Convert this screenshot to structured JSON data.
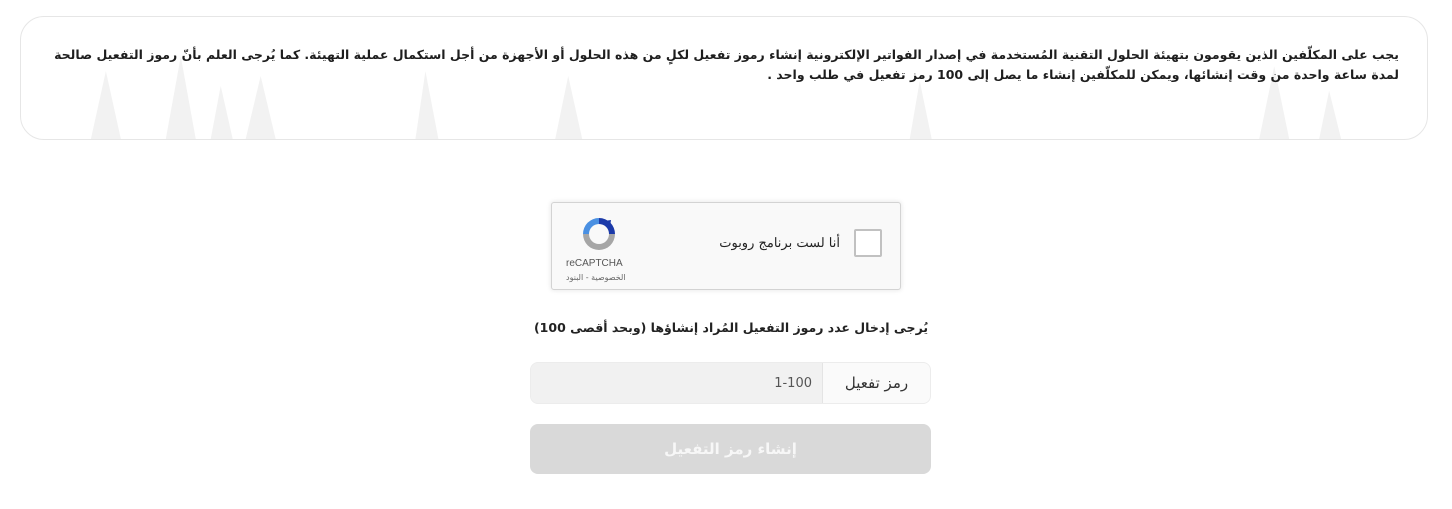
{
  "notice": {
    "text": "يجب على المكلّفين الذين يقومون بتهيئة الحلول التقنية المُستخدمة في إصدار الفواتير الإلكترونية إنشاء رموز تفعيل لكلٍ من هذه الحلول أو الأجهزة من أجل استكمال عملية التهيئة. كما يُرجى العلم بأنّ رموز التفعيل صالحة لمدة ساعة واحدة من وقت إنشائها، ويمكن للمكلّفين إنشاء ما يصل إلى 100 رمز تفعيل في طلب واحد ."
  },
  "recaptcha": {
    "label": "أنا لست برنامج روبوت",
    "brand": "reCAPTCHA",
    "terms": "الخصوصية - البنود",
    "checked": false,
    "icon": "recaptcha-logo-icon"
  },
  "form": {
    "hint": "يُرجى إدخال عدد رموز التفعيل المُراد إنشاؤها (وبحد أقصى 100)",
    "addon_label": "رمز تفعيل",
    "input_placeholder": "1-100",
    "input_value": "",
    "submit_label": "إنشاء رمز التفعيل",
    "submit_enabled": false
  },
  "colors": {
    "card_border": "#e6e6e6",
    "button_disabled": "#d9d9d9",
    "recaptcha_blue": "#4a90e2",
    "recaptcha_dark_blue": "#1c3aa9",
    "recaptcha_gray": "#b0b0b0"
  }
}
